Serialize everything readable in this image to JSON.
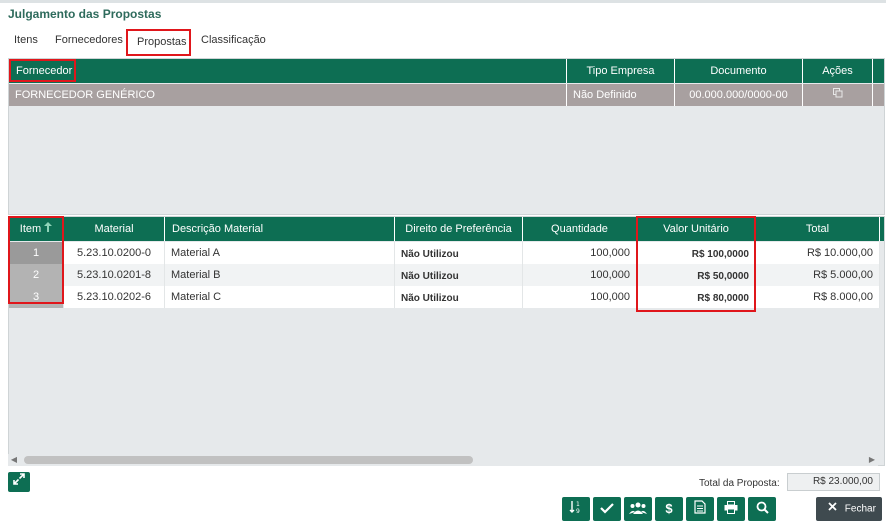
{
  "title": "Julgamento das Propostas",
  "tabs": [
    {
      "label": "Itens"
    },
    {
      "label": "Fornecedores"
    },
    {
      "label": "Propostas"
    },
    {
      "label": "Classificação"
    }
  ],
  "suppliers": {
    "headers": {
      "fornecedor": "Fornecedor",
      "tipo": "Tipo Empresa",
      "documento": "Documento",
      "acoes": "Ações"
    },
    "rows": [
      {
        "fornecedor": "FORNECEDOR GENÉRICO",
        "tipo": "Não Definido",
        "documento": "00.000.000/0000-00",
        "acao_icon": "copy-icon"
      }
    ]
  },
  "items": {
    "headers": {
      "item": "Item",
      "material": "Material",
      "descricao": "Descrição Material",
      "direito": "Direito de Preferência",
      "quantidade": "Quantidade",
      "valor": "Valor Unitário",
      "total": "Total"
    },
    "rows": [
      {
        "item": "1",
        "material": "5.23.10.0200-0",
        "descricao": "Material A",
        "direito": "Não Utilizou",
        "quantidade": "100,000",
        "valor": "R$ 100,0000",
        "total": "R$ 10.000,00"
      },
      {
        "item": "2",
        "material": "5.23.10.0201-8",
        "descricao": "Material B",
        "direito": "Não Utilizou",
        "quantidade": "100,000",
        "valor": "R$ 50,0000",
        "total": "R$ 5.000,00"
      },
      {
        "item": "3",
        "material": "5.23.10.0202-6",
        "descricao": "Material C",
        "direito": "Não Utilizou",
        "quantidade": "100,000",
        "valor": "R$ 80,0000",
        "total": "R$ 8.000,00"
      }
    ]
  },
  "footer": {
    "total_label": "Total da Proposta:",
    "total_value": "R$ 23.000,00",
    "close_label": "Fechar"
  },
  "colors": {
    "accent": "#0d6e53",
    "highlight": "#e0161b",
    "dark_button": "#3f4a4f"
  }
}
